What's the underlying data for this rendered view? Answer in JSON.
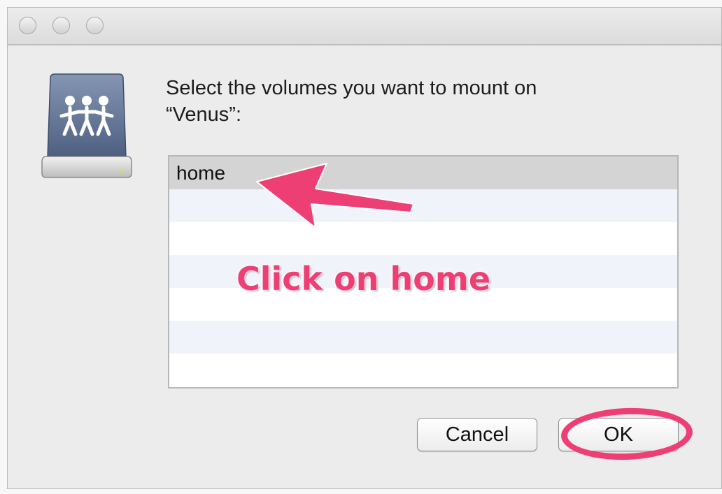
{
  "dialog": {
    "prompt_line1": "Select the volumes you want to mount on",
    "prompt_line2": "“Venus”:"
  },
  "volumes": [
    "home",
    "",
    "",
    "",
    "",
    "",
    ""
  ],
  "selected_volume": "home",
  "annotation": {
    "text": "Click on home",
    "color": "#ee3f75"
  },
  "buttons": {
    "cancel": "Cancel",
    "ok": "OK"
  },
  "icons": {
    "drive": "network-drive-icon",
    "window_controls": [
      "close-button",
      "minimize-button",
      "zoom-button"
    ]
  }
}
